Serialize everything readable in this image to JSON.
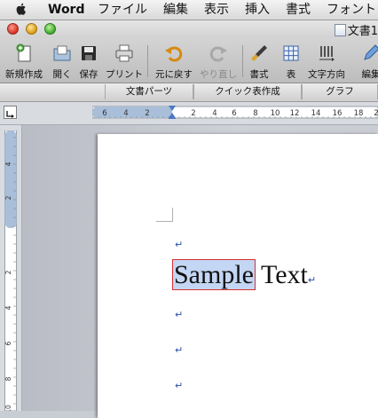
{
  "menubar": {
    "app": "Word",
    "items": [
      "ファイル",
      "編集",
      "表示",
      "挿入",
      "書式",
      "フォント"
    ]
  },
  "window": {
    "title": "文書1"
  },
  "toolbar": {
    "new": "新規作成",
    "open": "開く",
    "save": "保存",
    "print": "プリント",
    "undo": "元に戻す",
    "redo": "やり直し",
    "format": "書式",
    "table": "表",
    "text_direction": "文字方向",
    "edit": "編集"
  },
  "gallery": {
    "tabs": [
      "文書パーツ",
      "クイック表作成",
      "グラフ"
    ]
  },
  "ruler": {
    "h_ticks": [
      "6",
      "4",
      "2",
      "2",
      "4",
      "6",
      "8",
      "10",
      "12",
      "14",
      "16",
      "18",
      "2"
    ],
    "v_ticks": [
      "4",
      "2",
      "2",
      "4",
      "6",
      "8",
      "10"
    ]
  },
  "document": {
    "selected_word": "Sample",
    "rest_text": " Text",
    "para_mark": "↵"
  },
  "colors": {
    "selection": "#c3d6f3",
    "selection_outline": "#d83030",
    "para_mark": "#2a4fa8"
  }
}
